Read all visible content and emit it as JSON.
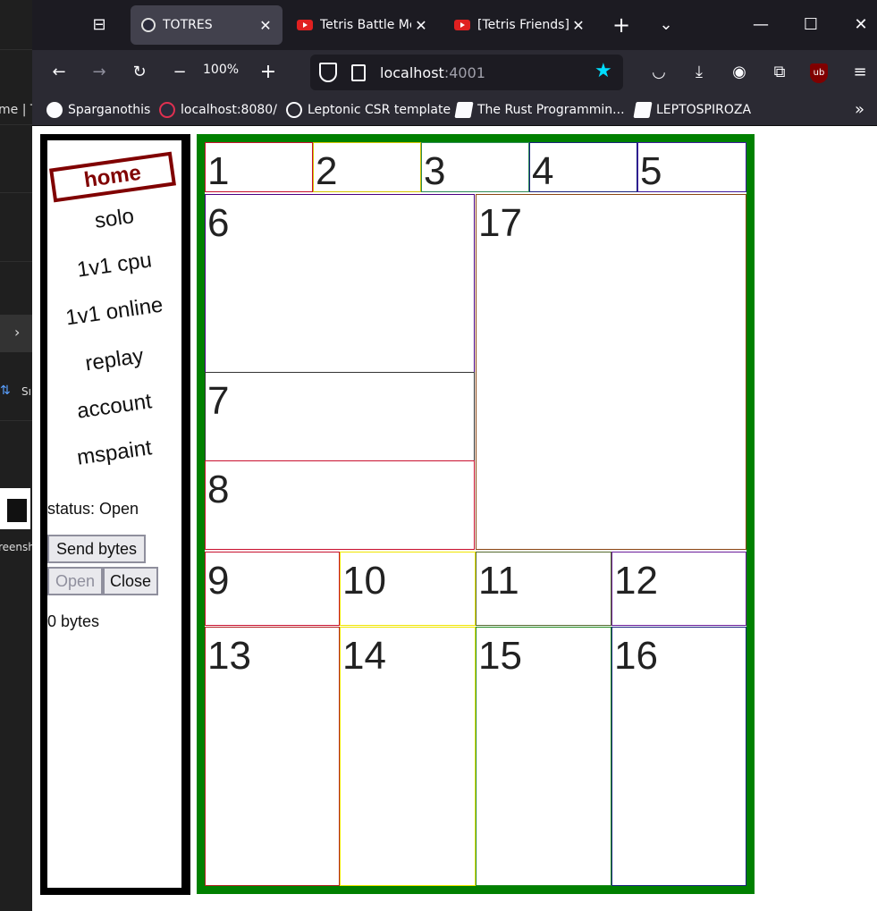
{
  "background_window": {
    "text_1": "me | Te",
    "text_2": "Sı",
    "text_3": "reensh"
  },
  "browser": {
    "tabs": [
      {
        "title": "TOTRES",
        "active": true
      },
      {
        "title": "Tetris Battle Me",
        "active": false
      },
      {
        "title": "[Tetris Friends] I",
        "active": false
      }
    ],
    "zoom": "100%",
    "url_host": "localhost",
    "url_port": ":4001",
    "bookmarks": [
      {
        "label": "Sparganothis"
      },
      {
        "label": "localhost:8080/"
      },
      {
        "label": "Leptonic CSR template"
      },
      {
        "label": "The Rust Programmin..."
      },
      {
        "label": "LEPTOSPIROZA"
      }
    ]
  },
  "sidebar": {
    "links": [
      "home",
      "solo",
      "1v1 cpu",
      "1v1 online",
      "replay",
      "account",
      "mspaint"
    ],
    "status": "status: Open",
    "send_button": "Send bytes",
    "open_button": "Open",
    "close_button": "Close",
    "bytes": "0 bytes"
  },
  "grid": {
    "cells": [
      "1",
      "2",
      "3",
      "4",
      "5",
      "6",
      "7",
      "8",
      "9",
      "10",
      "11",
      "12",
      "13",
      "14",
      "15",
      "16",
      "17"
    ],
    "border_colors": {
      "1": "#c8102e",
      "2": "#d4c400",
      "3": "#2e8b57",
      "4": "#1a237e",
      "5": "#3f1a9e",
      "6": "#4b0082",
      "7": "#333333",
      "8": "#c8102e",
      "9": "#c8102e",
      "10": "#f0e600",
      "11": "#556b2f",
      "12": "#6a1b9a",
      "13": "#b22222",
      "14": "#f0e600",
      "15": "#228b22",
      "16": "#1a237e",
      "17": "#8b4513"
    }
  },
  "colors": {
    "grid_frame": "#008000",
    "sidebar_frame": "#000000",
    "home_accent": "#800000",
    "star": "#00ddff"
  }
}
